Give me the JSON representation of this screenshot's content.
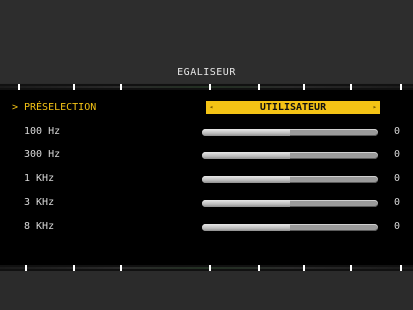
{
  "menu": {
    "title": "EGALISEUR",
    "preset": {
      "label": "PRÉSELECTION",
      "value": "UTILISATEUR",
      "arrow": ">",
      "left_arrow": "◂",
      "right_arrow": "▸"
    },
    "bands": [
      {
        "label": "100 Hz",
        "value": "0",
        "level": 0.5
      },
      {
        "label": "300 Hz",
        "value": "0",
        "level": 0.5
      },
      {
        "label": "1 KHz",
        "value": "0",
        "level": 0.5
      },
      {
        "label": "3 KHz",
        "value": "0",
        "level": 0.5
      },
      {
        "label": "8 KHz",
        "value": "0",
        "level": 0.5
      }
    ]
  },
  "colors": {
    "accent": "#f4c315",
    "background": "#000000",
    "frame": "#2b2b2b"
  }
}
